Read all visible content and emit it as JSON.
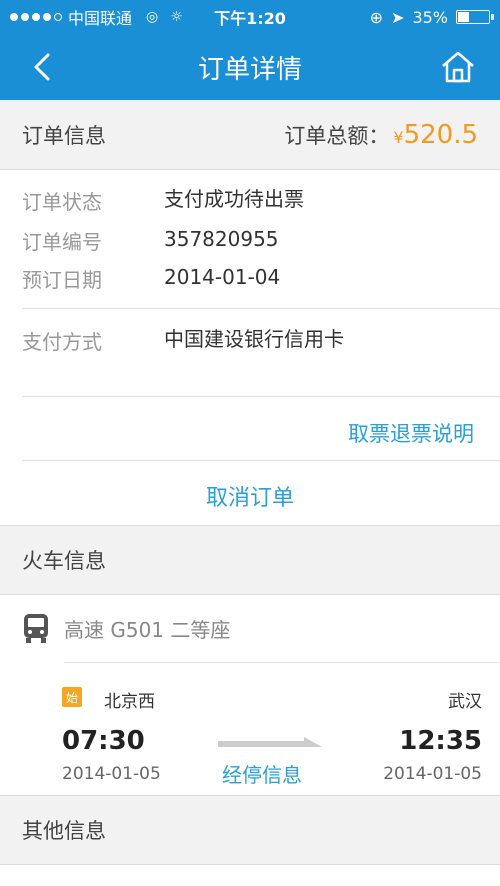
{
  "status_bar": {
    "carrier": "中国联通",
    "time": "下午1:20",
    "battery": "35%",
    "battery_level": 0.35
  },
  "nav": {
    "title": "订单详情",
    "back_icon": "chevron-left-icon",
    "home_icon": "home-icon"
  },
  "order_info": {
    "header": "订单信息",
    "total_label": "订单总额：",
    "currency": "¥",
    "total_amount": "520.5",
    "rows": [
      {
        "label": "订单状态",
        "value": "支付成功待出票"
      },
      {
        "label": "订单编号",
        "value": "357820955"
      },
      {
        "label": "预订日期",
        "value": "2014-01-04"
      }
    ],
    "payment_label": "支付方式",
    "payment_value": "中国建设银行信用卡",
    "refund_link": "取票退票说明",
    "cancel_button": "取消订单"
  },
  "train_info": {
    "header": "火车信息",
    "train_desc": "高速 G501 二等座",
    "start_badge": "始",
    "from_station": "北京西",
    "to_station": "武汉",
    "depart_time": "07:30",
    "depart_date": "2014-01-05",
    "arrive_time": "12:35",
    "arrive_date": "2014-01-05",
    "stops_link": "经停信息"
  },
  "other_info": {
    "header": "其他信息"
  },
  "colors": {
    "primary": "#1b8fd6",
    "accent": "#f39a1e",
    "link": "#2a9fd8"
  }
}
